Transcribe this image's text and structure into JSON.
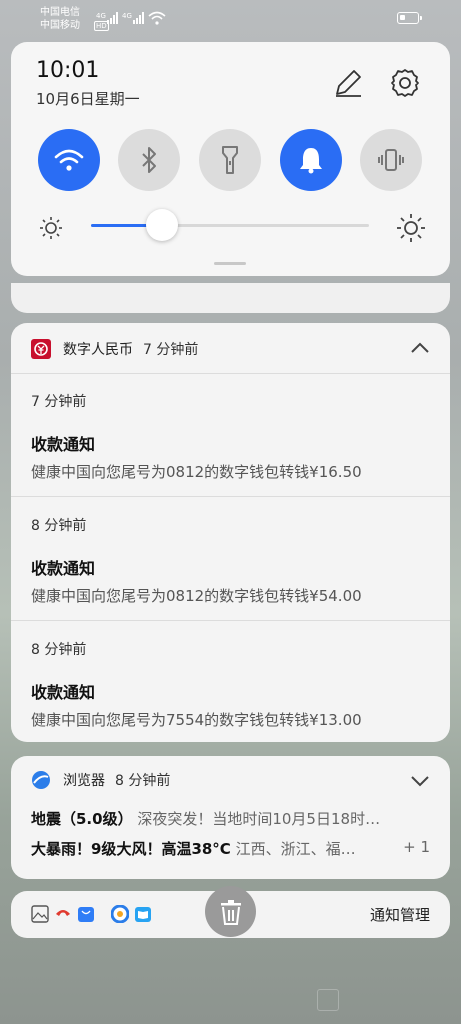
{
  "status_bar": {
    "carrier1": "中国电信",
    "carrier2": "中国移动",
    "hd": "HD",
    "signal_label": "4G",
    "battery_level_pct": 35
  },
  "quick_settings": {
    "time": "10:01",
    "date": "10月6日星期一",
    "brightness_pct": 25,
    "tiles": [
      {
        "name": "wifi",
        "on": true
      },
      {
        "name": "bluetooth",
        "on": false
      },
      {
        "name": "flashlight",
        "on": false
      },
      {
        "name": "sound",
        "on": true
      },
      {
        "name": "vibrate",
        "on": false
      }
    ],
    "accent": "#2a6df4"
  },
  "dcep": {
    "app": "数字人民币",
    "time": "7 分钟前",
    "messages": [
      {
        "time": "7 分钟前",
        "title": "收款通知",
        "body": "健康中国向您尾号为0812的数字钱包转钱¥16.50"
      },
      {
        "time": "8 分钟前",
        "title": "收款通知",
        "body": "健康中国向您尾号为0812的数字钱包转钱¥54.00"
      },
      {
        "time": "8 分钟前",
        "title": "收款通知",
        "body": "健康中国向您尾号为7554的数字钱包转钱¥13.00"
      }
    ]
  },
  "browser": {
    "app": "浏览器",
    "time": "8 分钟前",
    "line1_bold": "地震（5.0级）",
    "line1_rest": " 深夜突发！当地时间10月5日18时…",
    "line2_bold": "大暴雨！9级大风！高温38°C",
    "line2_rest": " 江西、浙江、福…",
    "more": "+ 1"
  },
  "bottom_bar": {
    "manage": "通知管理"
  }
}
